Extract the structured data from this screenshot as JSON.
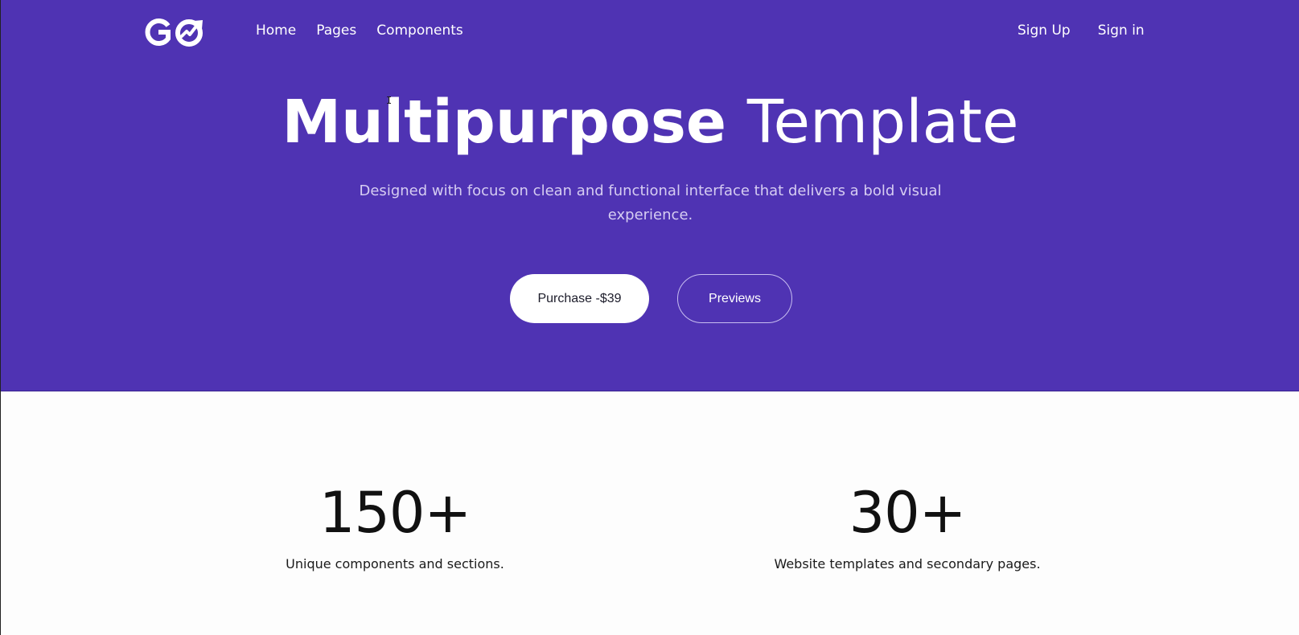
{
  "brand": {
    "logo_text": "GO",
    "logo_icon": "trending-check-icon",
    "colors": {
      "hero_bg": "#4f33b3",
      "text_on_hero": "#ffffff",
      "subtitle": "#d6cdf2"
    }
  },
  "nav": {
    "left": [
      "Home",
      "Pages",
      "Components"
    ],
    "right": [
      "Sign Up",
      "Sign in"
    ]
  },
  "hero": {
    "title_bold": "Multipurpose",
    "title_light": "Template",
    "subtitle_line1": "Designed with focus on clean and functional interface that delivers a bold visual",
    "subtitle_line2": "experience.",
    "primary_button": "Purchase -$39",
    "secondary_button": "Previews"
  },
  "stats": [
    {
      "number": "150+",
      "label": "Unique components and sections."
    },
    {
      "number": "30+",
      "label": "Website templates and secondary pages."
    }
  ]
}
